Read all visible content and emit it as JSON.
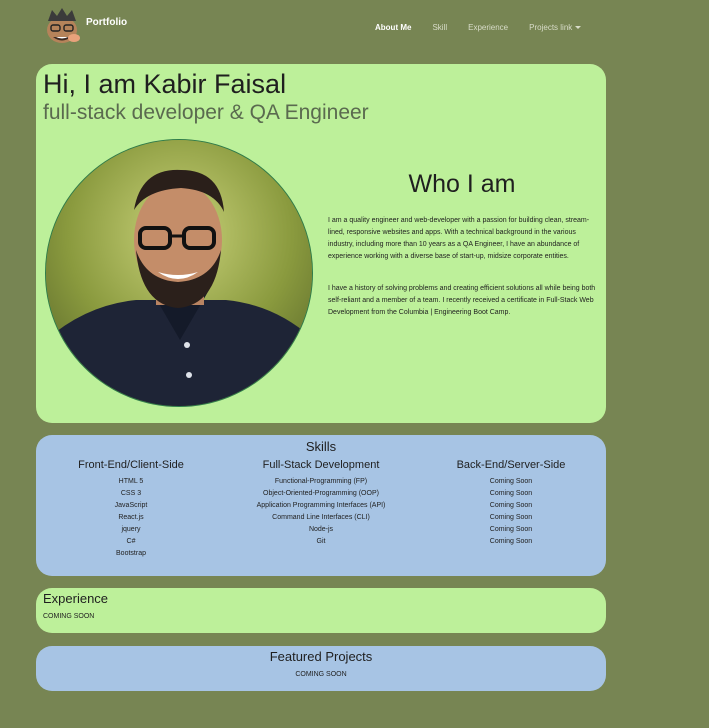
{
  "nav": {
    "brand": "Portfolio",
    "links": [
      {
        "label": "About Me",
        "active": true
      },
      {
        "label": "Skill",
        "active": false
      },
      {
        "label": "Experience",
        "active": false
      },
      {
        "label": "Projects link",
        "active": false,
        "dropdown": true
      }
    ]
  },
  "about": {
    "title": "Hi, I am Kabir Faisal",
    "subtitle": "full-stack developer & QA Engineer",
    "who_title": "Who I am",
    "paragraph1": "I am a quality engineer and web-developer with a passion for building clean, stream-lined, responsive websites and apps. With a technical background in the various industry, including more than 10 years as a QA Engineer, I have an abundance of experience working with a diverse base of start-up, midsize corporate entities.",
    "paragraph2": "I have a history of solving problems and creating efficient solutions all while being both self-reliant and a member of a team. I recently received a certificate in Full-Stack Web Development from the Columbia | Engineering Boot Camp."
  },
  "skills": {
    "title": "Skills",
    "columns": [
      {
        "heading": "Front-End/Client-Side",
        "items": [
          "HTML 5",
          "CSS 3",
          "JavaScript",
          "React.js",
          "jquery",
          "C#",
          "Bootstrap"
        ]
      },
      {
        "heading": "Full-Stack Development",
        "items": [
          "Functional-Programming (FP)",
          "Object-Oriented-Programming (OOP)",
          "Application Programming Interfaces (API)",
          "Command Line Interfaces (CLI)",
          "Node-js",
          "Git"
        ]
      },
      {
        "heading": "Back-End/Server-Side",
        "items": [
          "Coming Soon",
          "Coming Soon",
          "Coming Soon",
          "Coming Soon",
          "Coming Soon",
          "Coming Soon"
        ]
      }
    ]
  },
  "experience": {
    "title": "Experience",
    "text": "COMING SOON"
  },
  "projects": {
    "title": "Featured Projects",
    "text": "COMING SOON"
  },
  "colors": {
    "page_bg": "#778553",
    "green_card": "#bdf09a",
    "blue_card": "#a7c4e4"
  }
}
